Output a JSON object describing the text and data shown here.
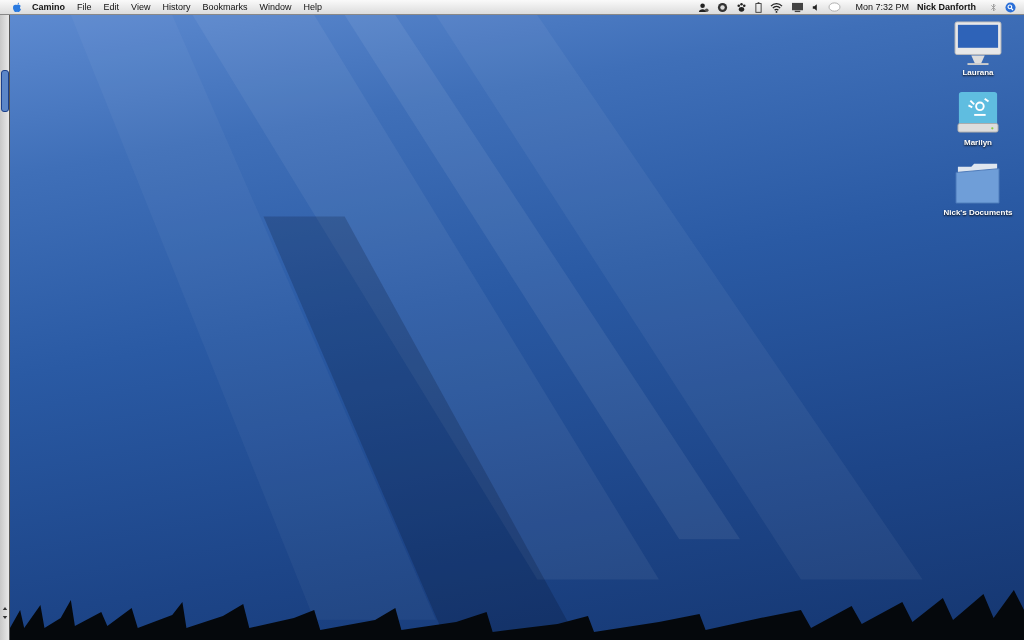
{
  "menu_bar": {
    "app_name": "Camino",
    "menus": [
      "File",
      "Edit",
      "View",
      "History",
      "Bookmarks",
      "Window",
      "Help"
    ],
    "clock": "Mon 7:32 PM",
    "user": "Nick Danforth"
  },
  "desktop_icons": [
    {
      "label": "Laurana",
      "kind": "computer"
    },
    {
      "label": "Marilyn",
      "kind": "drive"
    },
    {
      "label": "Nick's Documents",
      "kind": "folder"
    }
  ]
}
